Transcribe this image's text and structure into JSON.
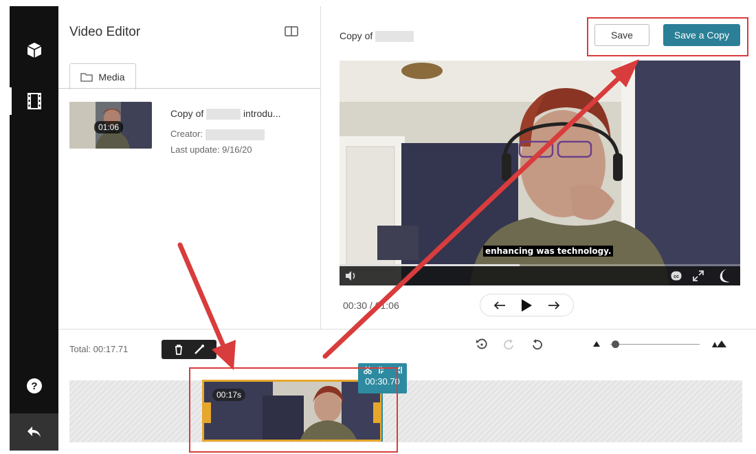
{
  "app": {
    "title": "Video Editor",
    "rail_items": [
      "cube-icon",
      "filmstrip-icon",
      "help-icon",
      "back-icon"
    ]
  },
  "media_panel": {
    "tab_label": "Media",
    "entry": {
      "duration": "01:06",
      "title_prefix": "Copy of",
      "title_suffix": "introdu...",
      "creator_label": "Creator:",
      "last_update": "Last update: 9/16/20"
    }
  },
  "player": {
    "title": "Copy of",
    "save_label": "Save",
    "save_copy_label": "Save a Copy",
    "caption": "enhancing was technology.",
    "time_readout": "00:30 / 01:06",
    "progress_fraction": 0.45
  },
  "timeline": {
    "total": "Total: 00:17.71",
    "clip_duration": "00:17s",
    "playhead_time": "00:30.70",
    "zoom_fraction": 0.05
  },
  "colors": {
    "accent": "#2b7f96",
    "clip_border": "#e6a72c",
    "annotation": "#d93c3c",
    "rail": "#111111"
  }
}
